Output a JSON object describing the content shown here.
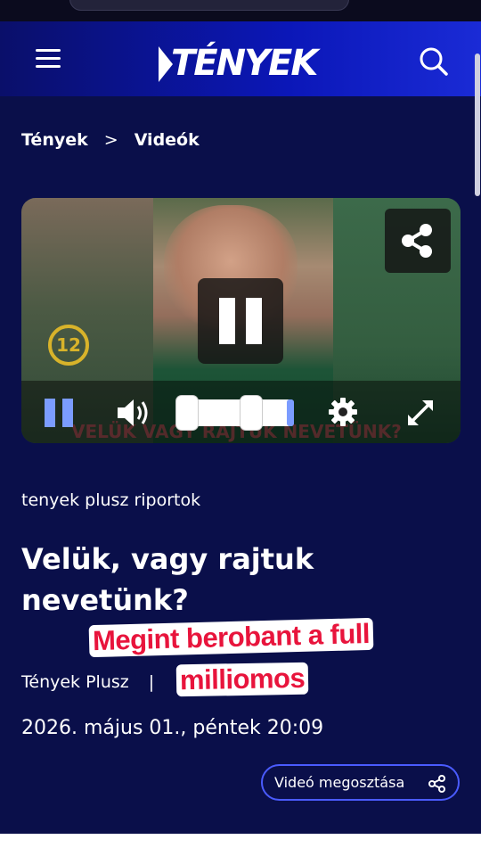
{
  "header": {
    "logo_text": "TÉNYEK",
    "menu_icon": "hamburger-menu-icon",
    "search_icon": "search-icon",
    "accent_color": "#0b17b8"
  },
  "breadcrumb": {
    "items": [
      "Tények",
      "Videók"
    ],
    "separator": ">"
  },
  "player": {
    "age_rating": "12",
    "share_icon": "share-icon",
    "controls": {
      "pause_icon": "pause-icon",
      "volume_icon": "volume-icon",
      "settings_icon": "gear-icon",
      "fullscreen_icon": "fullscreen-icon"
    },
    "overlay_text": "VELÜK VAGY RAJTUK NEVETÜNK?"
  },
  "article": {
    "category": "tenyek plusz riportok",
    "title": "Velük, vagy rajtuk nevetünk?",
    "author": "Tények Plusz",
    "divider": "|",
    "date": "2026. május 01., péntek 20:09",
    "share_label": "Videó megosztása"
  },
  "captions": {
    "line1": "Megint berobant a full",
    "line2": "milliomos"
  }
}
